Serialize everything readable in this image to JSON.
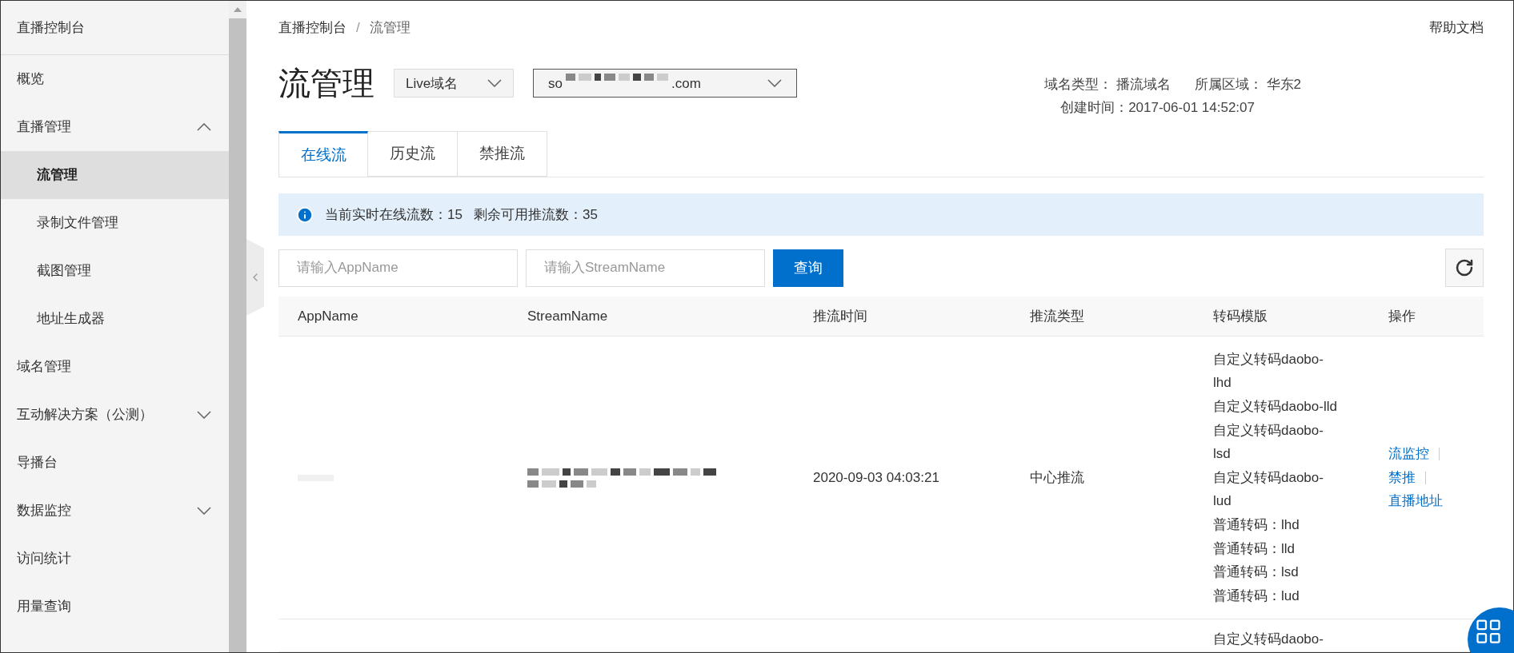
{
  "sidebar": {
    "title": "直播控制台",
    "items": [
      {
        "label": "概览",
        "selected": false
      },
      {
        "label": "直播管理",
        "selected": false,
        "expanded": true,
        "children": [
          {
            "label": "流管理",
            "selected": true
          },
          {
            "label": "录制文件管理",
            "selected": false
          },
          {
            "label": "截图管理",
            "selected": false
          },
          {
            "label": "地址生成器",
            "selected": false
          }
        ]
      },
      {
        "label": "域名管理",
        "selected": false
      },
      {
        "label": "互动解决方案（公测）",
        "selected": false,
        "expanded": false
      },
      {
        "label": "导播台",
        "selected": false
      },
      {
        "label": "数据监控",
        "selected": false,
        "expanded": false
      },
      {
        "label": "访问统计",
        "selected": false
      },
      {
        "label": "用量查询",
        "selected": false
      }
    ]
  },
  "breadcrumb": {
    "separator": "/",
    "items": [
      "直播控制台",
      "流管理"
    ]
  },
  "help_link": "帮助文档",
  "page_title": "流管理",
  "domain_type_select": {
    "value": "Live域名"
  },
  "domain_select": {
    "value_parts": [
      "so",
      ".com"
    ]
  },
  "domain_info": [
    {
      "label": "域名类型：",
      "value": "播流域名"
    },
    {
      "label": "所属区域：",
      "value": "华东2"
    },
    {
      "label": "创建时间：",
      "value": "2017-06-01 14:52:07"
    }
  ],
  "tabs": [
    {
      "label": "在线流",
      "selected": true
    },
    {
      "label": "历史流",
      "selected": false
    },
    {
      "label": "禁推流",
      "selected": false
    }
  ],
  "info_bar": [
    {
      "label": "当前实时在线流数：",
      "value": "15"
    },
    {
      "label": "剩余可用推流数：",
      "value": "35"
    }
  ],
  "filters": {
    "app_name": {
      "placeholder": "请输入AppName"
    },
    "stream_name": {
      "placeholder": "请输入StreamName"
    },
    "search_button": "查询"
  },
  "table": {
    "columns": [
      "AppName",
      "StreamName",
      "推流时间",
      "推流类型",
      "转码模版",
      "操作"
    ],
    "rows": [
      {
        "redacted": true,
        "push_time": "2020-09-03 04:03:21",
        "push_type": "中心推流",
        "templates": [
          "自定义转码daobo-lhd",
          "自定义转码daobo-lld",
          "自定义转码daobo-lsd",
          "自定义转码daobo-lud",
          "普通转码：lhd",
          "普通转码：lld",
          "普通转码：lsd",
          "普通转码：lud"
        ],
        "actions": [
          "流监控",
          "禁推",
          "直播地址"
        ]
      },
      {
        "redacted": false,
        "templates": [
          "自定义转码daobo-"
        ]
      }
    ]
  }
}
